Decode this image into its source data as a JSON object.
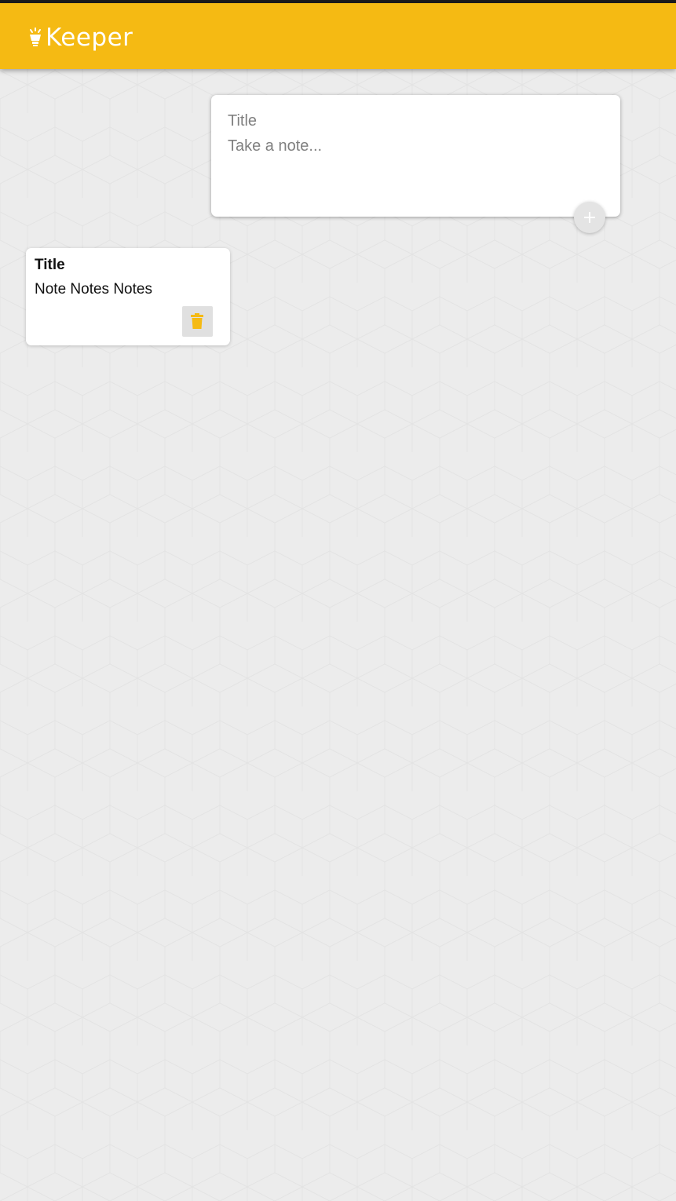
{
  "header": {
    "app_name": "Keeper",
    "logo_icon": "lightbulb-icon",
    "background_color": "#f5ba13"
  },
  "create_note": {
    "title_placeholder": "Title",
    "content_placeholder": "Take a note...",
    "add_icon": "plus-icon"
  },
  "notes": [
    {
      "title": "Title",
      "content": "Note Notes Notes",
      "delete_icon": "trash-icon"
    }
  ],
  "colors": {
    "accent": "#f5ba13",
    "background": "#ececec",
    "card": "#ffffff"
  }
}
